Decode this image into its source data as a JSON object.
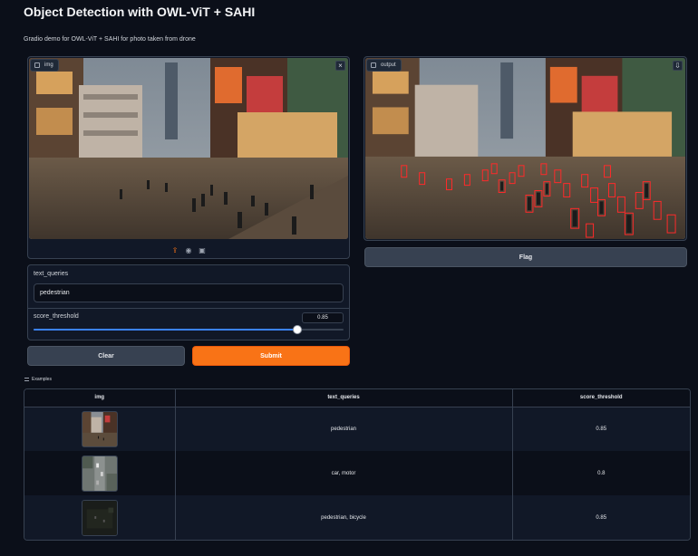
{
  "app": {
    "title": "Object Detection with OWL-ViT + SAHI",
    "subtitle": "Gradio demo for OWL-ViT + SAHI for photo taken from drone"
  },
  "input_image": {
    "label": "img",
    "close_icon": "close-icon",
    "tools": [
      "upload-icon",
      "webcam-icon",
      "clipboard-icon"
    ]
  },
  "output_image": {
    "label": "output",
    "download_icon": "download-icon"
  },
  "flag_label": "Flag",
  "text_queries": {
    "label": "text_queries",
    "value": "pedestrian"
  },
  "score_threshold": {
    "label": "score_threshold",
    "value": "0.85",
    "fraction": 0.85
  },
  "buttons": {
    "clear": "Clear",
    "submit": "Submit"
  },
  "examples": {
    "label": "Examples",
    "headers": [
      "img",
      "text_queries",
      "score_threshold"
    ],
    "rows": [
      {
        "text_queries": "pedestrian",
        "score_threshold": "0.85"
      },
      {
        "text_queries": "car, motor",
        "score_threshold": "0.8"
      },
      {
        "text_queries": "pedestrian, bicycle",
        "score_threshold": "0.85"
      }
    ]
  },
  "colors": {
    "accent": "#f97316",
    "slider": "#3b82f6",
    "background": "#0b0f19",
    "panel": "#111827",
    "detection_box": "#ff2a2a"
  }
}
